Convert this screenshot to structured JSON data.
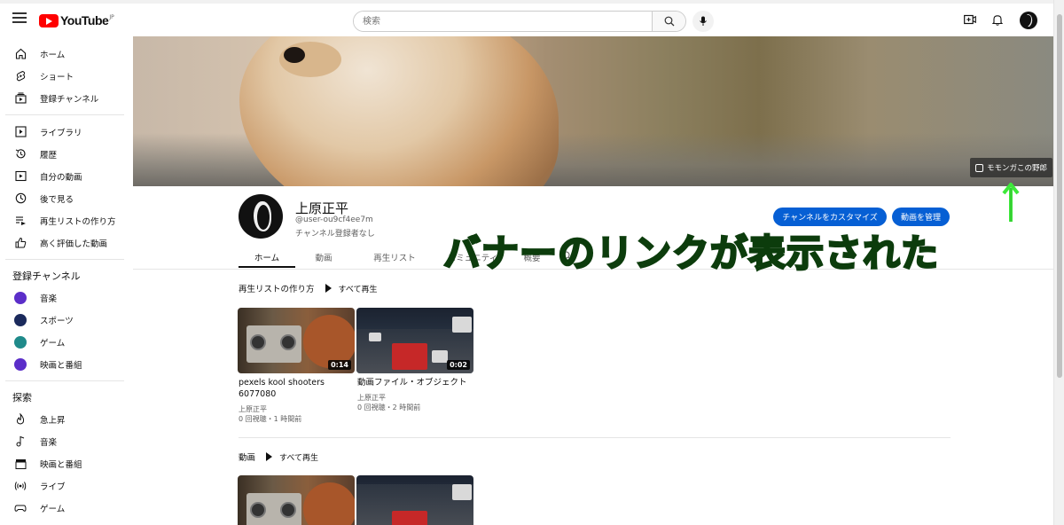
{
  "topbar": {
    "logo_text": "YouTube",
    "logo_region": "JP",
    "search_placeholder": "検索"
  },
  "sidebar": {
    "main": [
      {
        "label": "ホーム",
        "icon": "home-icon"
      },
      {
        "label": "ショート",
        "icon": "shorts-icon"
      },
      {
        "label": "登録チャンネル",
        "icon": "subscriptions-icon"
      }
    ],
    "library": [
      {
        "label": "ライブラリ",
        "icon": "library-icon"
      },
      {
        "label": "履歴",
        "icon": "history-icon"
      },
      {
        "label": "自分の動画",
        "icon": "my-videos-icon"
      },
      {
        "label": "後で見る",
        "icon": "watch-later-icon"
      },
      {
        "label": "再生リストの作り方",
        "icon": "playlist-icon"
      },
      {
        "label": "高く評価した動画",
        "icon": "liked-icon"
      }
    ],
    "subscriptions_heading": "登録チャンネル",
    "subscriptions": [
      {
        "label": "音楽",
        "color": "#5b2ec9"
      },
      {
        "label": "スポーツ",
        "color": "#1b2a5c"
      },
      {
        "label": "ゲーム",
        "color": "#1f8a8a"
      },
      {
        "label": "映画と番組",
        "color": "#5b2ec9"
      }
    ],
    "explore_heading": "探索",
    "explore": [
      {
        "label": "急上昇",
        "icon": "trending-icon"
      },
      {
        "label": "音楽",
        "icon": "music-icon"
      },
      {
        "label": "映画と番組",
        "icon": "film-icon"
      },
      {
        "label": "ライブ",
        "icon": "live-icon"
      },
      {
        "label": "ゲーム",
        "icon": "gaming-icon"
      }
    ]
  },
  "banner": {
    "link_label": "モモンガこの野郎"
  },
  "channel": {
    "name": "上原正平",
    "handle": "@user-ou9cf4ee7m",
    "subscribers": "チャンネル登録者なし",
    "customize_button": "チャンネルをカスタマイズ",
    "manage_button": "動画を管理"
  },
  "tabs": [
    "ホーム",
    "動画",
    "再生リスト",
    "コミュニティ",
    "概要"
  ],
  "section_playlist": {
    "title": "再生リストの作り方",
    "play_all": "すべて再生",
    "videos": [
      {
        "title": "pexels kool shooters 6077080",
        "channel": "上原正平",
        "meta": "0 回視聴・1 時間前",
        "duration": "0:14"
      },
      {
        "title": "動画ファイル・オブジェクト",
        "channel": "上原正平",
        "meta": "0 回視聴・2 時間前",
        "duration": "0:02"
      }
    ]
  },
  "section_videos": {
    "title": "動画",
    "play_all": "すべて再生"
  },
  "annotation": {
    "text": "バナーのリンクが表示された",
    "color": "#3de83a"
  }
}
